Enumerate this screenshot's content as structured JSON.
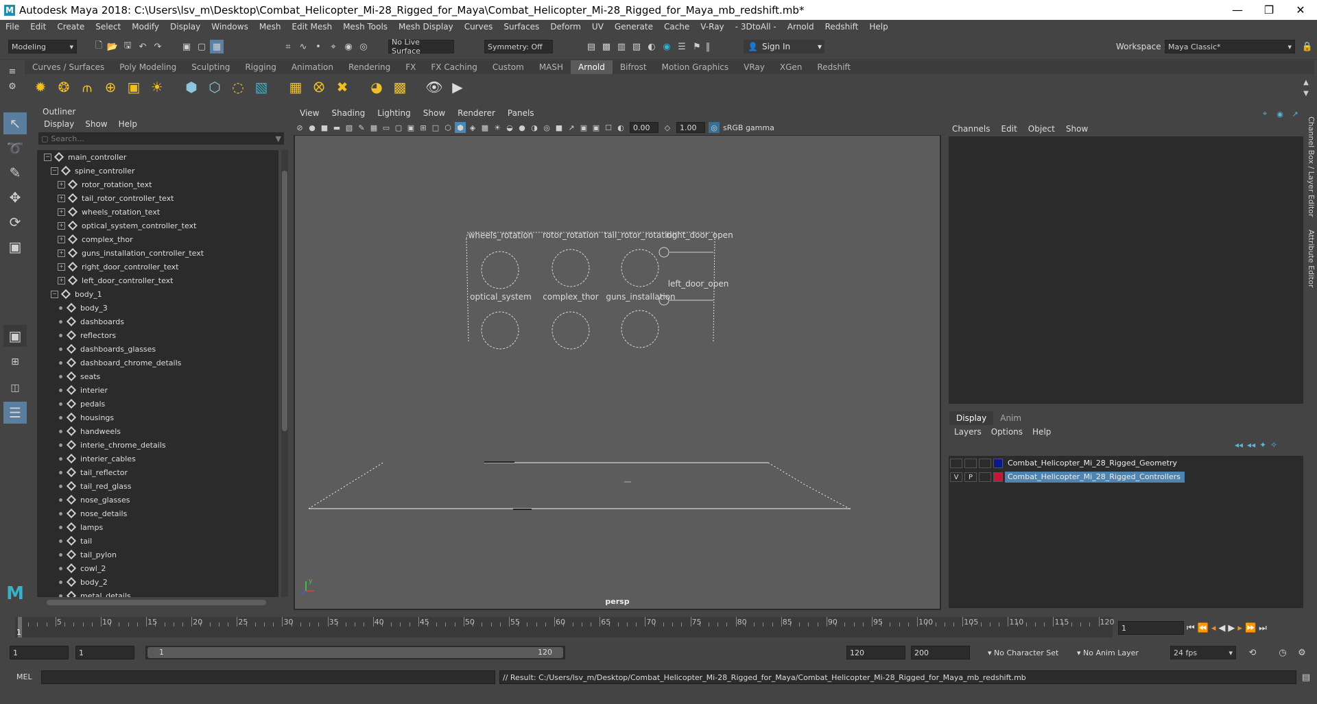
{
  "window": {
    "title": "Autodesk Maya 2018: C:\\Users\\lsv_m\\Desktop\\Combat_Helicopter_Mi-28_Rigged_for_Maya\\Combat_Helicopter_Mi-28_Rigged_for_Maya_mb_redshift.mb*",
    "logo": "M"
  },
  "menubar": [
    "File",
    "Edit",
    "Create",
    "Select",
    "Modify",
    "Display",
    "Windows",
    "Mesh",
    "Edit Mesh",
    "Mesh Tools",
    "Mesh Display",
    "Curves",
    "Surfaces",
    "Deform",
    "UV",
    "Generate",
    "Cache",
    "V-Ray",
    "- 3DtoAll -",
    "Arnold",
    "Redshift",
    "Help"
  ],
  "statusline": {
    "mode": "Modeling",
    "live_surface": "No Live Surface",
    "symmetry": "Symmetry: Off",
    "sign_in": "Sign In",
    "workspace_label": "Workspace :",
    "workspace": "Maya Classic*"
  },
  "shelf_tabs": [
    "Curves / Surfaces",
    "Poly Modeling",
    "Sculpting",
    "Rigging",
    "Animation",
    "Rendering",
    "FX",
    "FX Caching",
    "Custom",
    "MASH",
    "Arnold",
    "Bifrost",
    "Motion Graphics",
    "VRay",
    "XGen",
    "Redshift"
  ],
  "active_shelf_tab": "Arnold",
  "outliner": {
    "title": "Outliner",
    "menus": [
      "Display",
      "Show",
      "Help"
    ],
    "search_placeholder": "Search...",
    "items": [
      {
        "label": "main_controller",
        "level": 0,
        "expander": "minus"
      },
      {
        "label": "spine_controller",
        "level": 1,
        "expander": "minus"
      },
      {
        "label": "rotor_rotation_text",
        "level": 2,
        "expander": "plus"
      },
      {
        "label": "tail_rotor_controller_text",
        "level": 2,
        "expander": "plus"
      },
      {
        "label": "wheels_rotation_text",
        "level": 2,
        "expander": "plus"
      },
      {
        "label": "optical_system_controller_text",
        "level": 2,
        "expander": "plus"
      },
      {
        "label": "complex_thor",
        "level": 2,
        "expander": "plus"
      },
      {
        "label": "guns_installation_controller_text",
        "level": 2,
        "expander": "plus"
      },
      {
        "label": "right_door_controller_text",
        "level": 2,
        "expander": "plus"
      },
      {
        "label": "left_door_controller_text",
        "level": 2,
        "expander": "plus"
      },
      {
        "label": "body_1",
        "level": 1,
        "expander": "minus"
      },
      {
        "label": "body_3",
        "level": 2,
        "expander": "dot"
      },
      {
        "label": "dashboards",
        "level": 2,
        "expander": "dot"
      },
      {
        "label": "reflectors",
        "level": 2,
        "expander": "dot"
      },
      {
        "label": "dashboards_glasses",
        "level": 2,
        "expander": "dot"
      },
      {
        "label": "dashboard_chrome_details",
        "level": 2,
        "expander": "dot"
      },
      {
        "label": "seats",
        "level": 2,
        "expander": "dot"
      },
      {
        "label": "interier",
        "level": 2,
        "expander": "dot"
      },
      {
        "label": "pedals",
        "level": 2,
        "expander": "dot"
      },
      {
        "label": "housings",
        "level": 2,
        "expander": "dot"
      },
      {
        "label": "handweels",
        "level": 2,
        "expander": "dot"
      },
      {
        "label": "interie_chrome_details",
        "level": 2,
        "expander": "dot"
      },
      {
        "label": "interier_cables",
        "level": 2,
        "expander": "dot"
      },
      {
        "label": "tail_reflector",
        "level": 2,
        "expander": "dot"
      },
      {
        "label": "tail_red_glass",
        "level": 2,
        "expander": "dot"
      },
      {
        "label": "nose_glasses",
        "level": 2,
        "expander": "dot"
      },
      {
        "label": "nose_details",
        "level": 2,
        "expander": "dot"
      },
      {
        "label": "lamps",
        "level": 2,
        "expander": "dot"
      },
      {
        "label": "tail",
        "level": 2,
        "expander": "dot"
      },
      {
        "label": "tail_pylon",
        "level": 2,
        "expander": "dot"
      },
      {
        "label": "cowl_2",
        "level": 2,
        "expander": "dot"
      },
      {
        "label": "body_2",
        "level": 2,
        "expander": "dot"
      },
      {
        "label": "metal_details",
        "level": 2,
        "expander": "dot"
      }
    ]
  },
  "viewport": {
    "menus": [
      "View",
      "Shading",
      "Lighting",
      "Show",
      "Renderer",
      "Panels"
    ],
    "near_value": "0.00",
    "far_value": "1.00",
    "color_space": "sRGB gamma",
    "camera": "persp",
    "controller_labels": {
      "wheels": "wheels_rotation",
      "rotor": "rotor_rotation",
      "tail_rotor": "tail_rotor_rotation",
      "right_door": "right_door_open",
      "left_door": "left_door_open",
      "optical": "optical_system",
      "thor": "complex_thor",
      "guns": "guns_installation"
    }
  },
  "channel_box": {
    "menus": [
      "Channels",
      "Edit",
      "Object",
      "Show"
    ]
  },
  "layer_editor": {
    "tabs": [
      "Display",
      "Anim"
    ],
    "menus": [
      "Layers",
      "Options",
      "Help"
    ],
    "layers": [
      {
        "name": "Combat_Helicopter_Mi_28_Rigged_Geometry",
        "v": "",
        "p": "",
        "color": "#0b1a8a",
        "selected": false
      },
      {
        "name": "Combat_Helicopter_Mi_28_Rigged_Controllers",
        "v": "V",
        "p": "P",
        "color": "#c5163a",
        "selected": true
      }
    ]
  },
  "side_tabs": [
    "Channel Box / Layer Editor",
    "Attribute Editor"
  ],
  "time_slider": {
    "labels": [
      "5",
      "10",
      "15",
      "20",
      "25",
      "30",
      "35",
      "40",
      "45",
      "50",
      "55",
      "60",
      "65",
      "70",
      "75",
      "80",
      "85",
      "90",
      "95",
      "100",
      "105",
      "110",
      "115",
      "120"
    ],
    "current_marker": "1",
    "current_frame": "1"
  },
  "range_slider": {
    "start": "1",
    "start2": "1",
    "range_start": "1",
    "range_end": "120",
    "end": "120",
    "max_end": "200",
    "character_set": "No Character Set",
    "anim_layer": "No Anim Layer",
    "fps": "24 fps"
  },
  "command_line": {
    "label": "MEL",
    "result": "// Result: C:/Users/lsv_m/Desktop/Combat_Helicopter_Mi-28_Rigged_for_Maya/Combat_Helicopter_Mi-28_Rigged_for_Maya_mb_redshift.mb"
  }
}
